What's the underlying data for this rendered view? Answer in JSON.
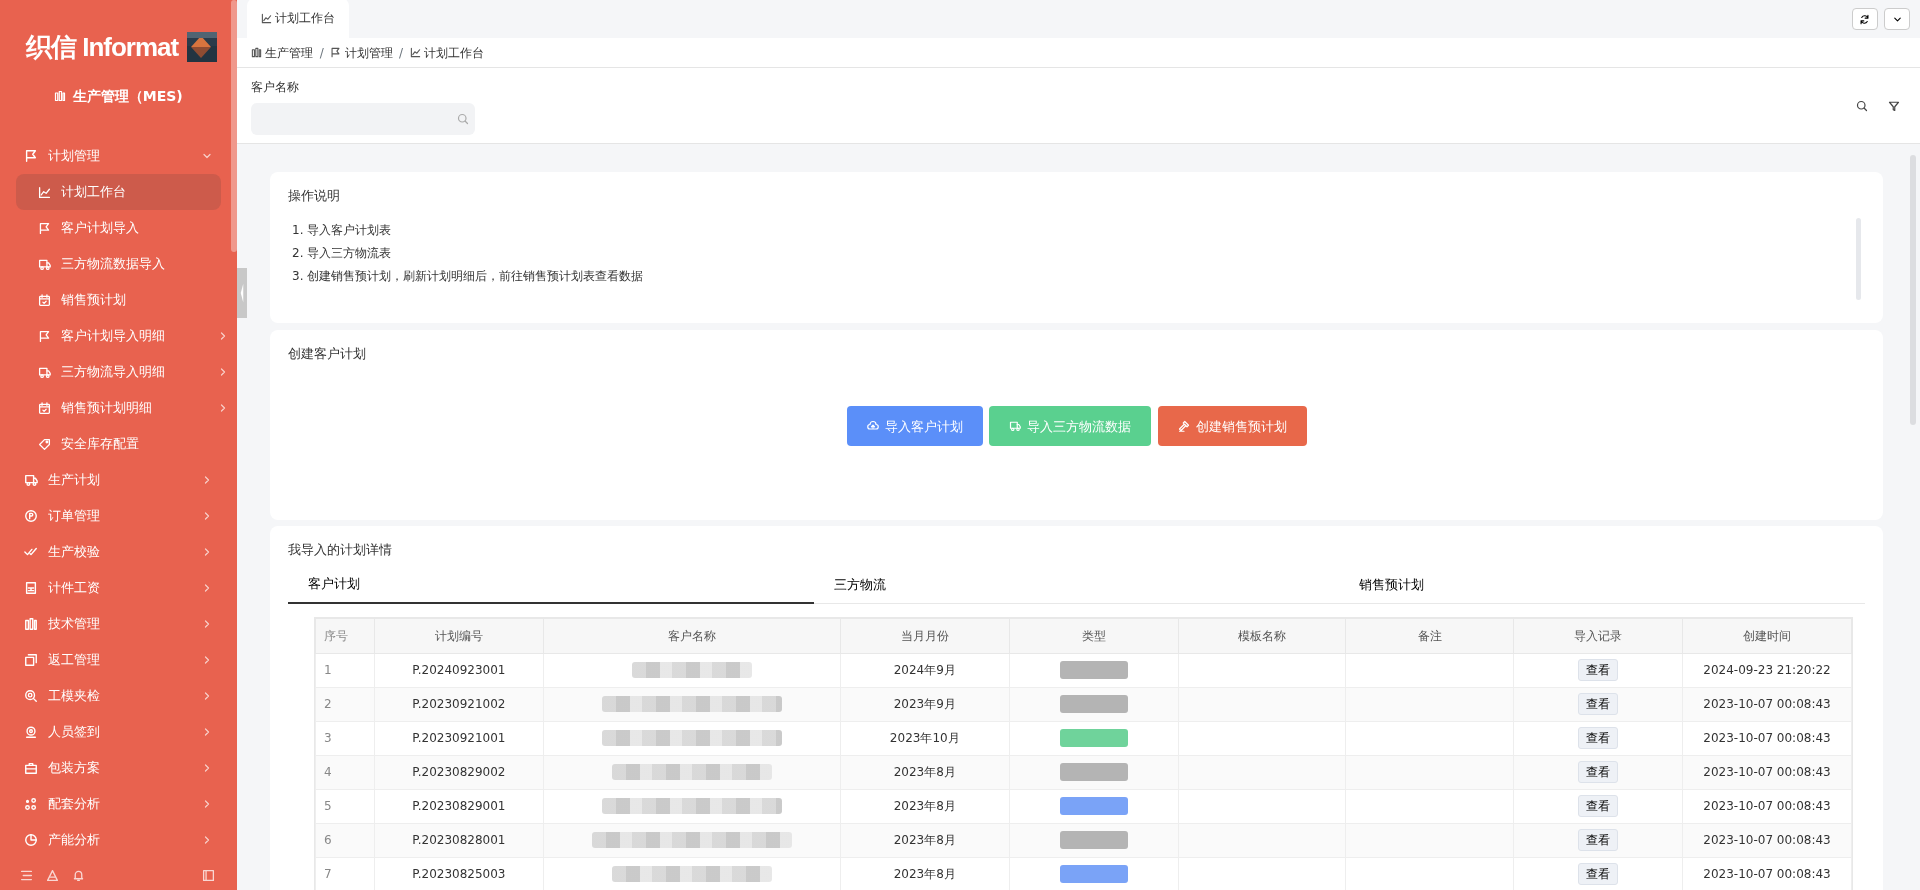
{
  "sidebar": {
    "logo": "织信 Informat",
    "module": "生产管理（MES)",
    "menu": [
      {
        "label": "计划管理",
        "expanded": true,
        "children": [
          {
            "label": "计划工作台",
            "selected": true,
            "expandable": false
          },
          {
            "label": "客户计划导入",
            "selected": false,
            "expandable": false
          },
          {
            "label": "三方物流数据导入",
            "selected": false,
            "expandable": false
          },
          {
            "label": "销售预计划",
            "selected": false,
            "expandable": false
          },
          {
            "label": "客户计划导入明细",
            "selected": false,
            "expandable": true
          },
          {
            "label": "三方物流导入明细",
            "selected": false,
            "expandable": true
          },
          {
            "label": "销售预计划明细",
            "selected": false,
            "expandable": true
          },
          {
            "label": "安全库存配置",
            "selected": false,
            "expandable": false
          }
        ]
      },
      {
        "label": "生产计划",
        "expanded": false
      },
      {
        "label": "订单管理",
        "expanded": false
      },
      {
        "label": "生产校验",
        "expanded": false
      },
      {
        "label": "计件工资",
        "expanded": false
      },
      {
        "label": "技术管理",
        "expanded": false
      },
      {
        "label": "返工管理",
        "expanded": false
      },
      {
        "label": "工模夹检",
        "expanded": false
      },
      {
        "label": "人员签到",
        "expanded": false
      },
      {
        "label": "包装方案",
        "expanded": false
      },
      {
        "label": "配套分析",
        "expanded": false
      },
      {
        "label": "产能分析",
        "expanded": false
      }
    ]
  },
  "page_tab": {
    "label": "计划工作台"
  },
  "breadcrumb": {
    "separator": "/",
    "items": [
      "生产管理",
      "计划管理",
      "计划工作台"
    ]
  },
  "filter": {
    "label": "客户名称"
  },
  "instructions": {
    "title": "操作说明",
    "steps": [
      "1. 导入客户计划表",
      "2. 导入三方物流表",
      "3. 创建销售预计划，刷新计划明细后，前往销售预计划表查看数据"
    ]
  },
  "create": {
    "title": "创建客户计划",
    "buttons": [
      {
        "label": "导入客户计划",
        "color": "#5b8ff9"
      },
      {
        "label": "导入三方物流数据",
        "color": "#5ad08f"
      },
      {
        "label": "创建销售预计划",
        "color": "#e8684a"
      }
    ]
  },
  "details": {
    "title": "我导入的计划详情",
    "tabs": [
      {
        "label": "客户计划",
        "selected": true
      },
      {
        "label": "三方物流",
        "selected": false
      },
      {
        "label": "销售预计划",
        "selected": false
      }
    ],
    "table": {
      "columns": [
        "序号",
        "计划编号",
        "客户名称",
        "当月月份",
        "类型",
        "模板名称",
        "备注",
        "导入记录",
        "创建时间"
      ],
      "rows": [
        {
          "index": "1",
          "plan_no": "P.20240923001",
          "month": "2024年9月",
          "color": "#b4b4b4",
          "action": "查看",
          "created": "2024-09-23 21:20:22"
        },
        {
          "index": "2",
          "plan_no": "P.20230921002",
          "month": "2023年9月",
          "color": "#b4b4b4",
          "action": "查看",
          "created": "2023-10-07 00:08:43"
        },
        {
          "index": "3",
          "plan_no": "P.20230921001",
          "month": "2023年10月",
          "color": "#6fd39b",
          "action": "查看",
          "created": "2023-10-07 00:08:43"
        },
        {
          "index": "4",
          "plan_no": "P.20230829002",
          "month": "2023年8月",
          "color": "#b4b4b4",
          "action": "查看",
          "created": "2023-10-07 00:08:43"
        },
        {
          "index": "5",
          "plan_no": "P.20230829001",
          "month": "2023年8月",
          "color": "#7aa3f7",
          "action": "查看",
          "created": "2023-10-07 00:08:43"
        },
        {
          "index": "6",
          "plan_no": "P.20230828001",
          "month": "2023年8月",
          "color": "#b4b4b4",
          "action": "查看",
          "created": "2023-10-07 00:08:43"
        },
        {
          "index": "7",
          "plan_no": "P.20230825003",
          "month": "2023年8月",
          "color": "#7aa3f7",
          "action": "查看",
          "created": "2023-10-07 00:08:43"
        }
      ]
    }
  }
}
